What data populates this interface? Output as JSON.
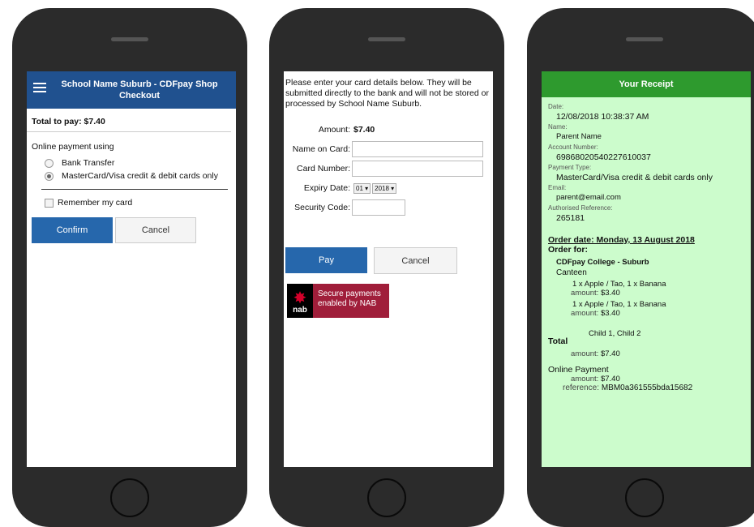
{
  "phone1": {
    "header_title": "School Name Suburb - CDFpay Shop Checkout",
    "total": "Total to pay: $7.40",
    "online_payment_label": "Online payment using",
    "options": [
      "Bank Transfer",
      "MasterCard/Visa credit & debit cards only"
    ],
    "selected_option": "MasterCard/Visa credit & debit cards only",
    "remember_card": "Remember my card",
    "confirm": "Confirm",
    "cancel": "Cancel"
  },
  "phone2": {
    "intro": "Please enter your card details below. They will be submitted directly to the bank and will not be stored or processed by School Name Suburb.",
    "amount_label": "Amount:",
    "amount_value": "$7.40",
    "name_label": "Name on Card:",
    "card_label": "Card Number:",
    "expiry_label": "Expiry Date:",
    "expiry_month": "01",
    "expiry_year": "2018",
    "security_label": "Security Code:",
    "pay": "Pay",
    "cancel": "Cancel",
    "nab_word": "nab",
    "nab_text_1": "Secure payments",
    "nab_text_2": "enabled by NAB"
  },
  "phone3": {
    "title": "Your Receipt",
    "date_label": "Date:",
    "date": "12/08/2018 10:38:37 AM",
    "name_label": "Name:",
    "name": "Parent Name",
    "account_label": "Account Number:",
    "account": "69868020540227610037",
    "payment_type_label": "Payment Type:",
    "payment_type": "MasterCard/Visa credit & debit cards only",
    "email_label": "Email:",
    "email": "parent@email.com",
    "auth_label": "Authorised Reference:",
    "auth": "265181",
    "order_date": "Order date: Monday, 13 August 2018",
    "order_for": "Order for:",
    "shop": "CDFpay College - Suburb",
    "canteen": "Canteen",
    "items": [
      {
        "desc": "1 x Apple / Tao, 1 x Banana",
        "amount_label": "amount:",
        "amount": "$3.40"
      },
      {
        "desc": "1 x Apple / Tao, 1 x Banana",
        "amount_label": "amount:",
        "amount": "$3.40"
      }
    ],
    "children": "Child 1, Child 2",
    "total_label": "Total",
    "total_amount_label": "amount:",
    "total_amount": "$7.40",
    "online_payment": "Online Payment",
    "online_amount_label": "amount:",
    "online_amount": "$7.40",
    "reference_label": "reference:",
    "reference": "MBM0a361555bda15682"
  }
}
